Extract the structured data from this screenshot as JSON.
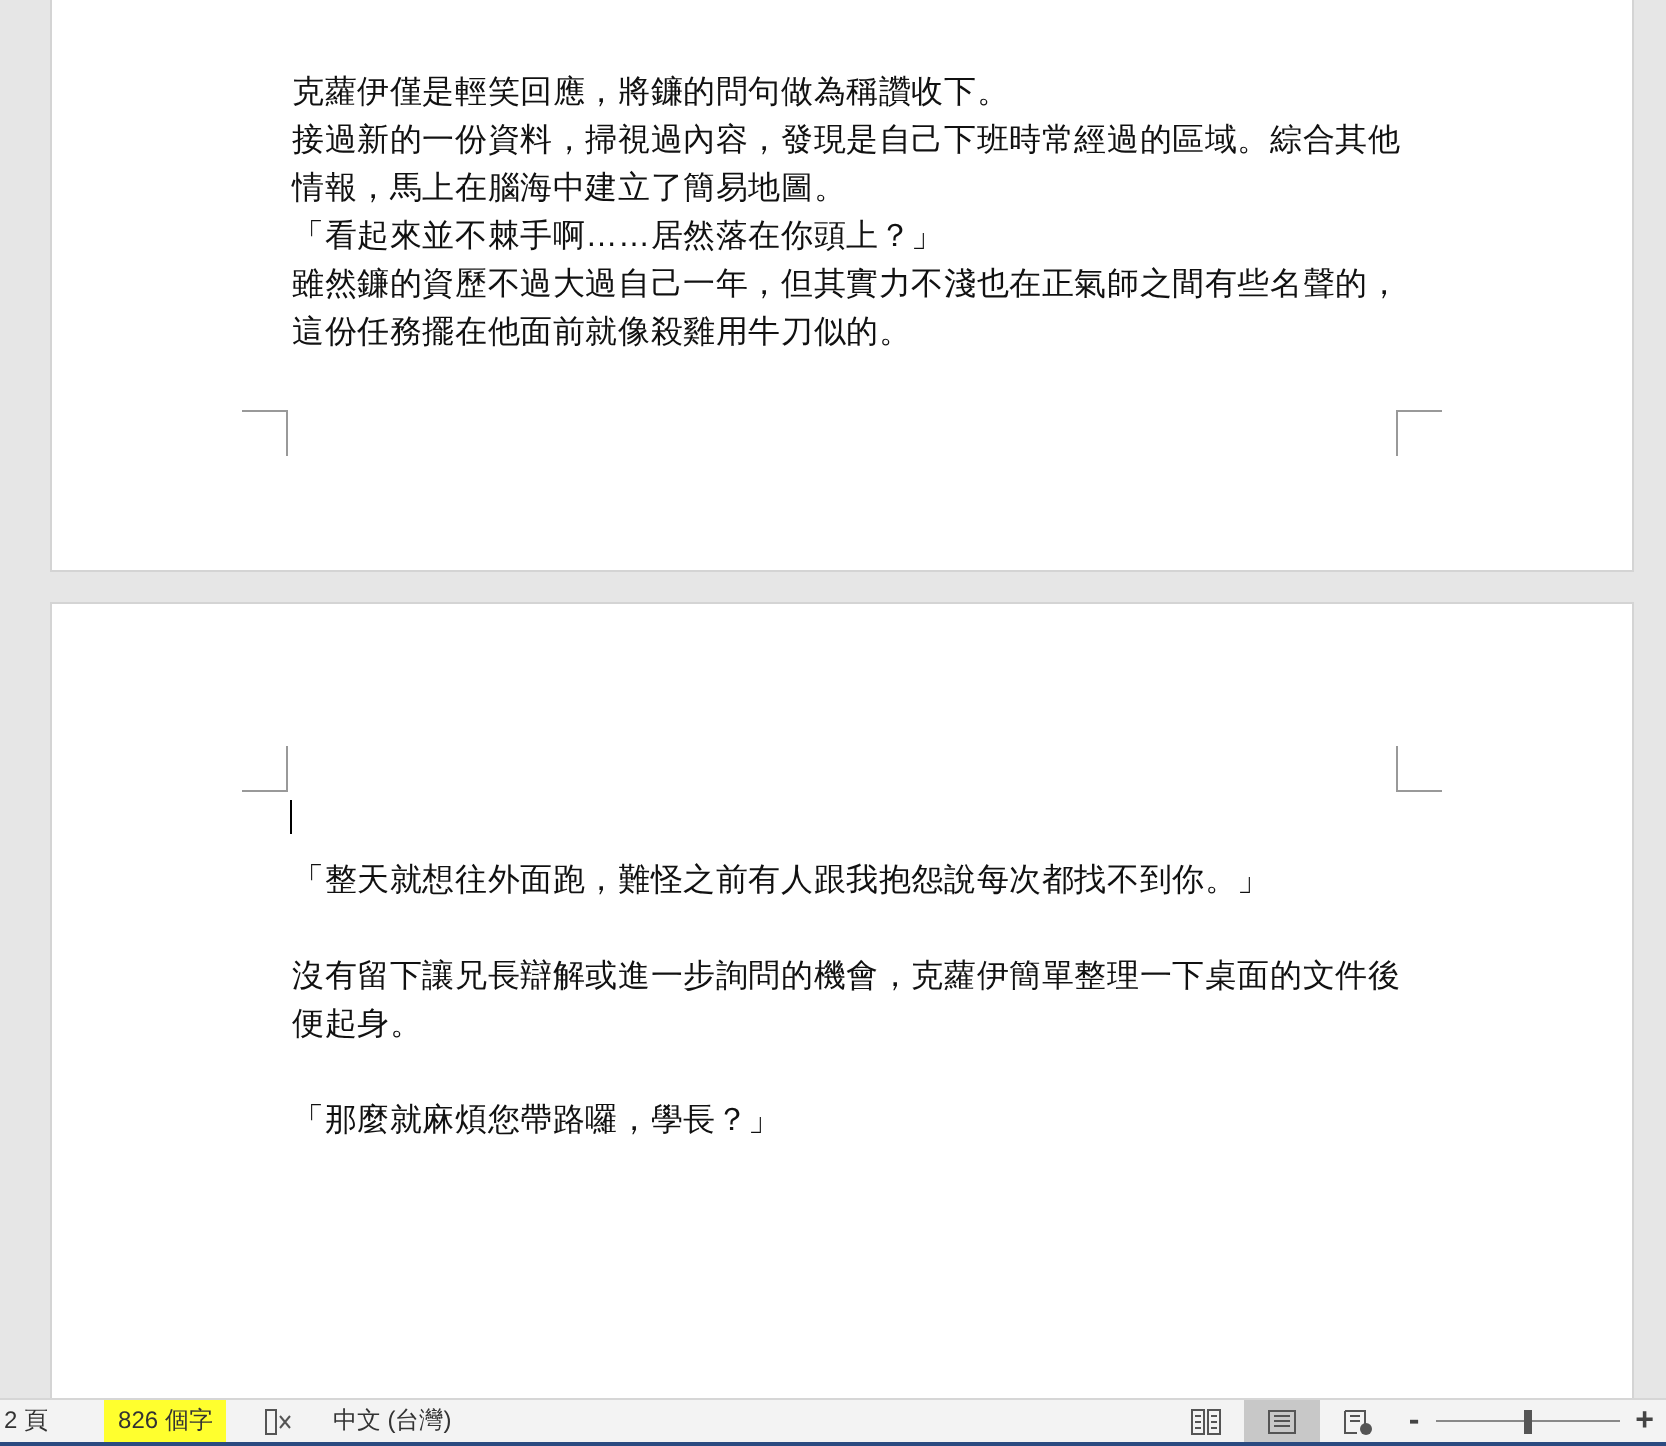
{
  "pages": [
    {
      "paragraphs": [
        {
          "lines": [
            "克蘿伊僅是輕笑回應，將鐮的問句做為稱讚收下。"
          ]
        },
        {
          "lines": [
            "接過新的一份資料，掃視過內容，發現是自己下班時常經過的區域。綜合其他",
            "情報，馬上在腦海中建立了簡易地圖。"
          ]
        },
        {
          "lines": [
            "「看起來並不棘手啊……居然落在你頭上？」"
          ]
        },
        {
          "lines": [
            "雖然鐮的資歷不過大過自己一年，但其實力不淺也在正氣師之間有些名聲的，",
            "這份任務擺在他面前就像殺雞用牛刀似的。"
          ]
        }
      ]
    },
    {
      "paragraphs": [
        {
          "lines": [
            "「整天就想往外面跑，難怪之前有人跟我抱怨說每次都找不到你。」"
          ]
        },
        {
          "lines": [
            "沒有留下讓兄長辯解或進一步詢問的機會，克蘿伊簡單整理一下桌面的文件後",
            "便起身。"
          ]
        },
        {
          "lines": [
            "「那麼就麻煩您帶路囉，學長？」"
          ]
        }
      ]
    }
  ],
  "status_bar": {
    "pages": "2 頁",
    "word_count": "826 個字",
    "language": "中文 (台灣)",
    "views": [
      {
        "kind": "read",
        "selected": false
      },
      {
        "kind": "print",
        "selected": true
      },
      {
        "kind": "web",
        "selected": false
      }
    ],
    "zoom_minus": "-",
    "zoom_plus": "+",
    "zoom": {
      "level": 0.5
    }
  }
}
